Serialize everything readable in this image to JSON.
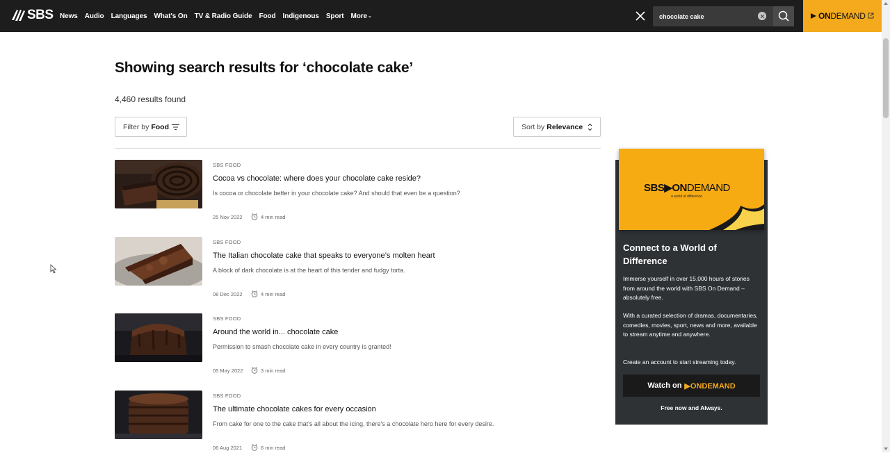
{
  "brand": {
    "logo_text": "SBS"
  },
  "nav": {
    "items": [
      {
        "label": "News"
      },
      {
        "label": "Audio"
      },
      {
        "label": "Languages"
      },
      {
        "label": "What's On"
      },
      {
        "label": "TV & Radio Guide"
      },
      {
        "label": "Food"
      },
      {
        "label": "Indigenous"
      },
      {
        "label": "Sport"
      }
    ],
    "more_label": "More",
    "more_caret": "⌄"
  },
  "search": {
    "value": "chocolate cake"
  },
  "ondemand_top": {
    "label_bold": "ON",
    "label_rest": "DEMAND"
  },
  "results": {
    "title": "Showing search results for ‘chocolate cake’",
    "count": "4,460 results found",
    "filter": {
      "prefix": "Filter by",
      "value": "Food"
    },
    "sort": {
      "prefix": "Sort by",
      "value": "Relevance"
    }
  },
  "articles": [
    {
      "source": "SBS FOOD",
      "title": "Cocoa vs chocolate: where does your chocolate cake reside?",
      "description": "Is cocoa or chocolate better in your chocolate cake? And should that even be a question?",
      "date": "25 Nov 2022",
      "read_time": "4 min read"
    },
    {
      "source": "SBS FOOD",
      "title": "The Italian chocolate cake that speaks to everyone’s molten heart",
      "description": "A block of dark chocolate is at the heart of this tender and fudgy torta.",
      "date": "08 Dec 2022",
      "read_time": "4 min read"
    },
    {
      "source": "SBS FOOD",
      "title": "Around the world in... chocolate cake",
      "description": "Permission to smash chocolate cake in every country is granted!",
      "date": "05 May 2022",
      "read_time": "3 min read"
    },
    {
      "source": "SBS FOOD",
      "title": "The ultimate chocolate cakes for every occasion",
      "description": "From cake for one to the cake that’s all about the icing, there’s a chocolate hero here for every desire.",
      "date": "06 Aug 2021",
      "read_time": "6 min read"
    }
  ],
  "promo": {
    "logo_sbs": "SBS",
    "logo_on": "ON",
    "logo_demand": "DEMAND",
    "tagline": "a world of difference",
    "heading": "Connect to a World of Difference",
    "para1": "Immerse yourself in over 15,000 hours of stories from around the world with SBS On Demand – absolutely free.",
    "para2": "With a curated selection of dramas, documentaries, comedies, movies, sport, news and more, available to stream anytime and anywhere.",
    "para3": "Create an account to start streaming today.",
    "watch_label": "Watch on",
    "watch_brand": "ONDEMAND",
    "free_text": "Free now and Always."
  },
  "colors": {
    "accent": "#f4aa1c",
    "topbar": "#1d1d1d",
    "promo_bg": "#2f3235"
  }
}
